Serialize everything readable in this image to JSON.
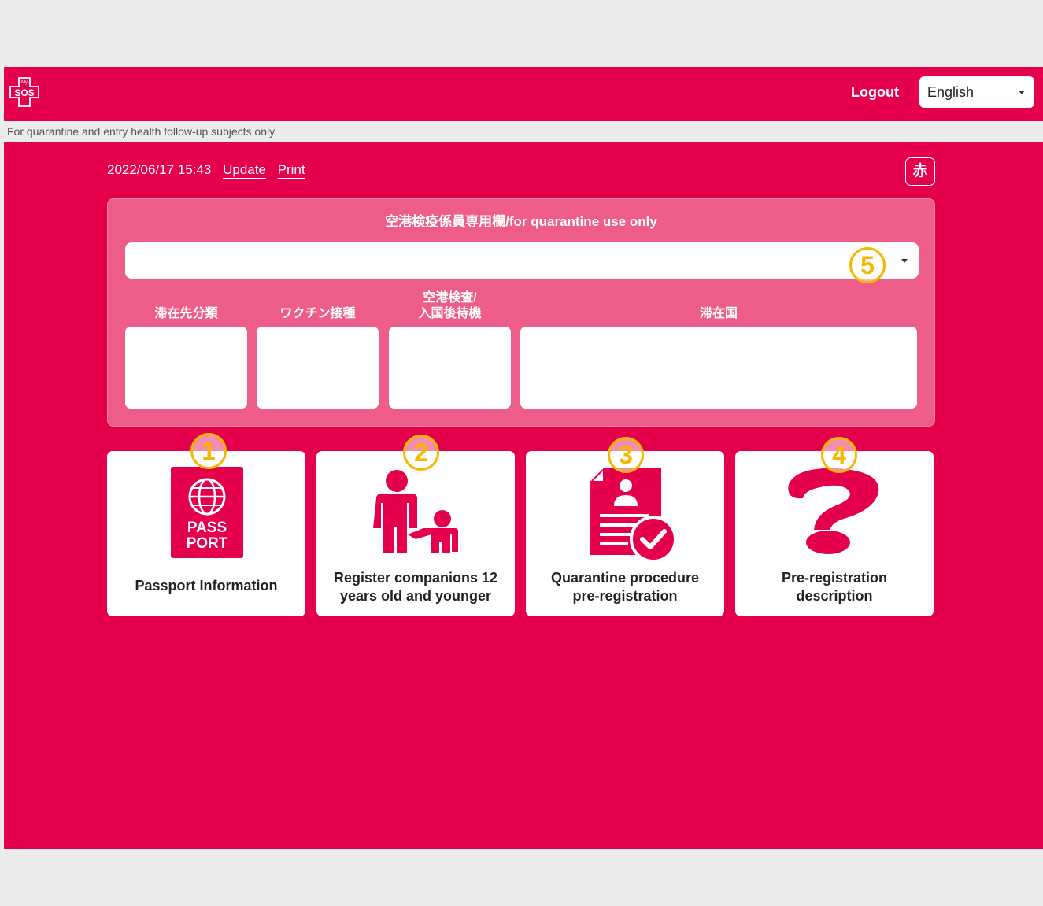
{
  "header": {
    "logo_text": "SOS",
    "logo_small": "My",
    "logout_label": "Logout",
    "language": {
      "selected": "English"
    }
  },
  "notice": "For quarantine and entry health follow-up subjects only",
  "meta": {
    "timestamp": "2022/06/17 15:43",
    "update_label": "Update",
    "print_label": "Print",
    "red_button_label": "赤"
  },
  "quarantine_panel": {
    "title": "空港検疫係員専用欄/for quarantine use only",
    "select_badge": "5",
    "columns": [
      {
        "label_line1": "滞在先分類",
        "label_line2": ""
      },
      {
        "label_line1": "ワクチン接種",
        "label_line2": ""
      },
      {
        "label_line1": "空港検査/",
        "label_line2": "入国後待機"
      },
      {
        "label_line1": "滞在国",
        "label_line2": ""
      }
    ]
  },
  "cards": [
    {
      "badge": "1",
      "line1": "Passport Information",
      "line2": "",
      "icon": "passport-icon",
      "passport_text1": "PASS",
      "passport_text2": "PORT"
    },
    {
      "badge": "2",
      "line1": "Register companions 12",
      "line2": "years old and younger",
      "icon": "parent-child-icon"
    },
    {
      "badge": "3",
      "line1": "Quarantine procedure",
      "line2": "pre-registration",
      "icon": "document-check-icon"
    },
    {
      "badge": "4",
      "line1": "Pre-registration",
      "line2": "description",
      "icon": "question-mark-icon"
    }
  ],
  "colors": {
    "brand": "#e4004b",
    "panel": "#ee5c89",
    "badge": "#f5b800"
  }
}
